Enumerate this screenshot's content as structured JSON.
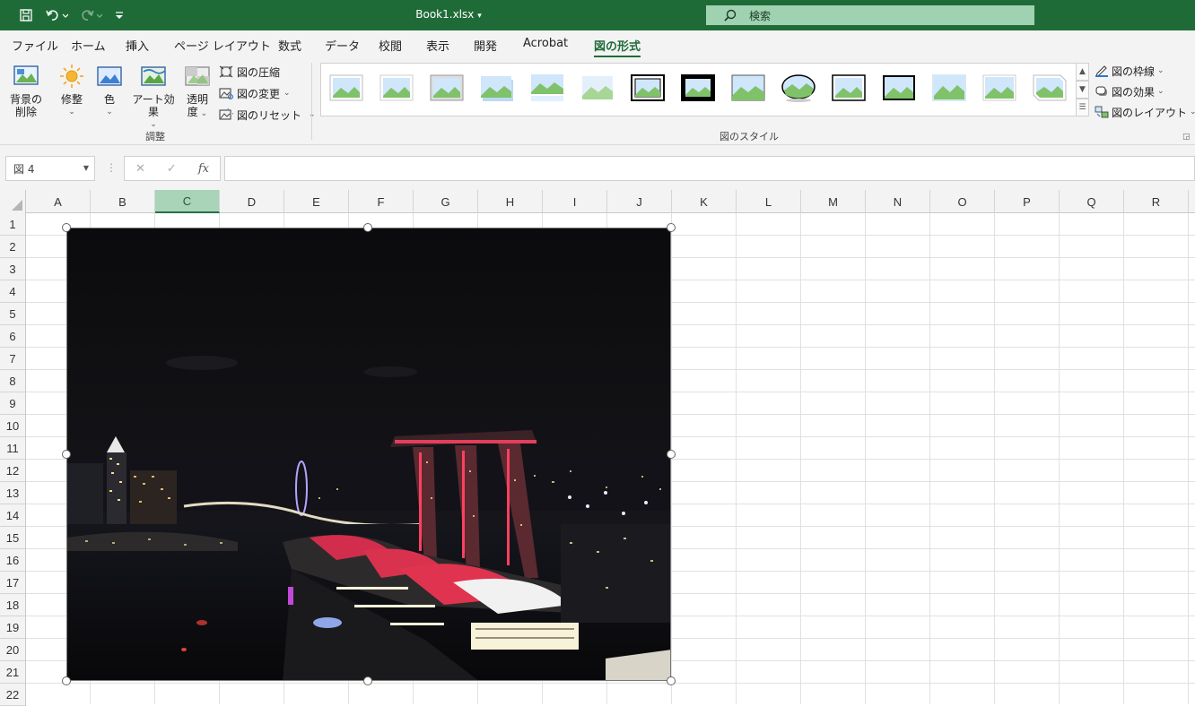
{
  "titlebar": {
    "filename": "Book1.xlsx",
    "search_placeholder": "検索"
  },
  "tabs": [
    "ファイル",
    "ホーム",
    "挿入",
    "ページ レイアウト",
    "数式",
    "データ",
    "校閲",
    "表示",
    "開発",
    "Acrobat",
    "図の形式"
  ],
  "active_tab": "図の形式",
  "ribbon": {
    "adjust": {
      "remove_bg": [
        "背景の",
        "削除"
      ],
      "corrections": "修整",
      "color": "色",
      "artistic": "アート効果",
      "transparency": [
        "透明",
        "度"
      ],
      "compress": "図の圧縮",
      "change": "図の変更",
      "reset": "図のリセット",
      "label": "調整"
    },
    "styles": {
      "label": "図のスタイル",
      "border": "図の枠線",
      "effects": "図の効果",
      "layout": "図のレイアウト"
    }
  },
  "formula_bar": {
    "name_box": "図 4",
    "fx": "fx",
    "value": ""
  },
  "grid": {
    "columns": [
      "A",
      "B",
      "C",
      "D",
      "E",
      "F",
      "G",
      "H",
      "I",
      "J",
      "K",
      "L",
      "M",
      "N",
      "O",
      "P",
      "Q",
      "R"
    ],
    "selected_column": "C",
    "rows": [
      "1",
      "2",
      "3",
      "4",
      "5",
      "6",
      "7",
      "8",
      "9",
      "10",
      "11",
      "12",
      "13",
      "14",
      "15",
      "16",
      "17",
      "18",
      "19",
      "20",
      "21",
      "22"
    ]
  },
  "colors": {
    "accent": "#1f6b38",
    "selected_header": "#a9d4b7"
  }
}
